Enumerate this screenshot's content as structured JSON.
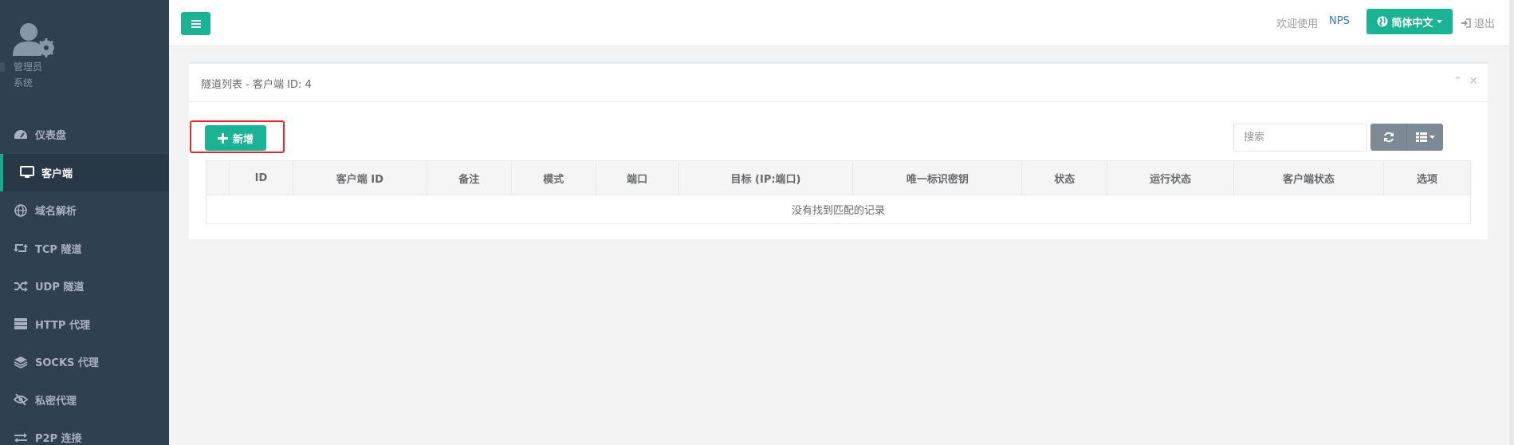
{
  "sidebar": {
    "profile": {
      "role": "管理员",
      "subtitle": "系统"
    },
    "items": [
      {
        "label": "仪表盘",
        "icon": "dashboard-icon"
      },
      {
        "label": "客户端",
        "icon": "desktop-icon",
        "active": true
      },
      {
        "label": "域名解析",
        "icon": "globe-icon"
      },
      {
        "label": "TCP 隧道",
        "icon": "retweet-icon"
      },
      {
        "label": "UDP 隧道",
        "icon": "random-icon"
      },
      {
        "label": "HTTP 代理",
        "icon": "server-icon"
      },
      {
        "label": "SOCKS 代理",
        "icon": "layers-icon"
      },
      {
        "label": "私密代理",
        "icon": "eye-slash-icon"
      },
      {
        "label": "P2P 连接",
        "icon": "exchange-icon"
      }
    ]
  },
  "topbar": {
    "welcome": "欢迎使用",
    "brand": "NPS",
    "language": "简体中文",
    "logout": "退出"
  },
  "panel": {
    "title": "隧道列表 - 客户端 ID: 4",
    "add_label": "新增",
    "search_placeholder": "搜索"
  },
  "table": {
    "columns": [
      "",
      "ID",
      "客户端 ID",
      "备注",
      "模式",
      "端口",
      "目标 (IP:端口)",
      "唯一标识密钥",
      "状态",
      "运行状态",
      "客户端状态",
      "选项"
    ],
    "empty_message": "没有找到匹配的记录"
  },
  "colors": {
    "sidebar": "#2f4050",
    "accent": "#1ab394",
    "highlight": "#e8242d"
  }
}
